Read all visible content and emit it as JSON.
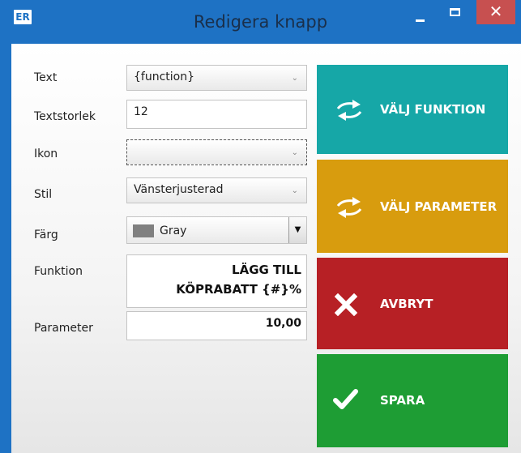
{
  "window": {
    "app_icon_text": "ER",
    "title": "Redigera knapp",
    "close_glyph": "✕"
  },
  "form": {
    "text": {
      "label": "Text",
      "value": "{function}"
    },
    "font_size": {
      "label": "Textstorlek",
      "value": "12"
    },
    "icon": {
      "label": "Ikon",
      "value": ""
    },
    "style": {
      "label": "Stil",
      "value": "Vänsterjusterad"
    },
    "color": {
      "label": "Färg",
      "value": "Gray",
      "swatch": "#808080"
    },
    "function": {
      "label": "Funktion",
      "line1": "LÄGG TILL",
      "line2": "KÖPRABATT {#}%"
    },
    "parameter": {
      "label": "Parameter",
      "value": "10,00"
    }
  },
  "actions": {
    "choose_function": {
      "label": "VÄLJ FUNKTION",
      "icon": "swap-arrows-icon",
      "color": "#16a7a7"
    },
    "choose_parameter": {
      "label": "VÄLJ PARAMETER",
      "icon": "swap-arrows-icon",
      "color": "#d89c0e"
    },
    "cancel": {
      "label": "AVBRYT",
      "icon": "x-icon",
      "color": "#b72025"
    },
    "save": {
      "label": "SPARA",
      "icon": "check-icon",
      "color": "#1e9d34"
    }
  },
  "colors": {
    "titlebar": "#1e72c4",
    "close_button": "#c75050"
  }
}
